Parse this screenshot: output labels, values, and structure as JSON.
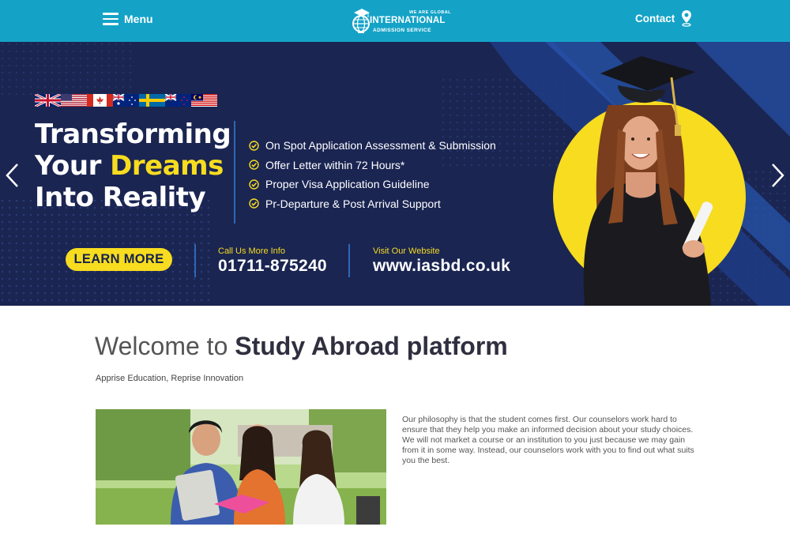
{
  "header": {
    "menu_label": "Menu",
    "logo": {
      "small_text": "WE ARE GLOBAL",
      "main_text": "INTERNATIONAL",
      "sub_text": "ADMISSION SERVICE"
    },
    "contact_label": "Contact",
    "icons": [
      "hamburger-icon",
      "location-pin-icon"
    ],
    "background_color": "#14a3c7"
  },
  "banner": {
    "flags": [
      "uk",
      "usa",
      "canada",
      "australia",
      "sweden",
      "new-zealand",
      "malaysia"
    ],
    "headline_line1": "Transforming",
    "headline_line2_prefix": "Your ",
    "headline_line2_highlight": "Dreams",
    "headline_line3": "Into Reality",
    "bullets": [
      "On Spot Application Assessment & Submission",
      "Offer Letter within 72 Hours*",
      "Proper Visa Application Guideline",
      "Pr-Departure & Post Arrival Support"
    ],
    "cta_label": "LEARN MORE",
    "call_label": "Call Us More Info",
    "phone": "01711-875240",
    "website_label": "Visit Our Website",
    "website": "www.iasbd.co.uk",
    "colors": {
      "background": "#1a2552",
      "accent": "#f7dc1f"
    }
  },
  "content": {
    "welcome_light": "Welcome to ",
    "welcome_bold": "Study Abroad platform",
    "tagline": "Apprise Education, Reprise Innovation",
    "philosophy": "Our philosophy is that the student comes first. Our counselors work hard to ensure that they help you make an informed decision about your study choices. We will not market a course or an institution to you just because we may gain from it in some way. Instead, our counselors work with you to find out what suits you the best."
  }
}
